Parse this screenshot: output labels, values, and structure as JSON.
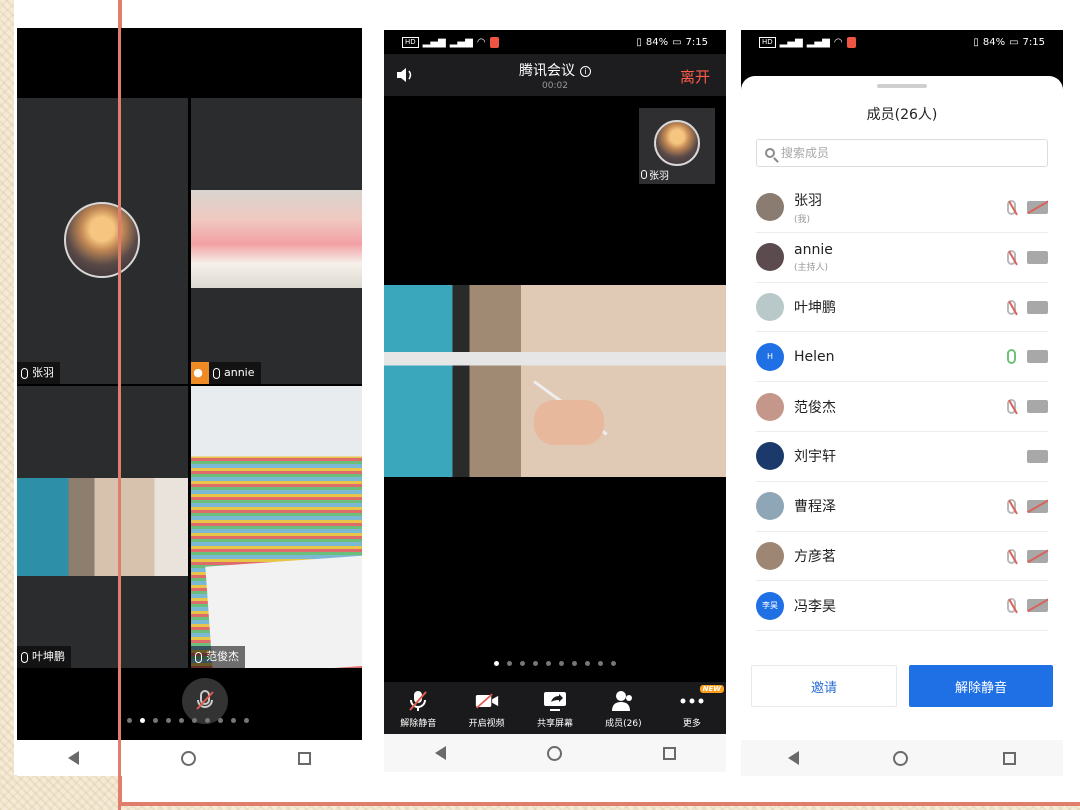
{
  "phone1": {
    "tiles": [
      {
        "name": "张羽",
        "type": "avatar"
      },
      {
        "name": "annie",
        "type": "video",
        "host": true
      },
      {
        "name": "叶坤鹏",
        "type": "video"
      },
      {
        "name": "范俊杰",
        "type": "video"
      }
    ],
    "pager": {
      "count": 10,
      "active": 1
    }
  },
  "phone2": {
    "status": {
      "battery": "84%",
      "time": "7:15"
    },
    "title": "腾讯会议",
    "timer": "00:02",
    "leave": "离开",
    "pip_name": "张羽",
    "pager": {
      "count": 10,
      "active": 0
    },
    "toolbar": [
      {
        "label": "解除静音",
        "icon": "muted-mic-icon"
      },
      {
        "label": "开启视频",
        "icon": "video-off-icon"
      },
      {
        "label": "共享屏幕",
        "icon": "share-screen-icon"
      },
      {
        "label": "成员(26)",
        "icon": "members-icon"
      },
      {
        "label": "更多",
        "icon": "more-icon",
        "badge": "NEW"
      }
    ]
  },
  "phone3": {
    "status": {
      "battery": "84%",
      "time": "7:15"
    },
    "title": "成员(26人)",
    "search_placeholder": "搜索成员",
    "members": [
      {
        "name": "张羽",
        "role": "(我)",
        "avatar_color": "#8a7c70",
        "mic": "muted",
        "cam": "off"
      },
      {
        "name": "annie",
        "role": "(主持人)",
        "avatar_color": "#5b4a4e",
        "mic": "muted",
        "cam": "on"
      },
      {
        "name": "叶坤鹏",
        "role": "",
        "avatar_color": "#b9c9c9",
        "mic": "muted",
        "cam": "on"
      },
      {
        "name": "Helen",
        "role": "",
        "avatar_color": "#1f6fe5",
        "avatar_text": "H",
        "mic": "active",
        "cam": "on"
      },
      {
        "name": "范俊杰",
        "role": "",
        "avatar_color": "#c4978a",
        "mic": "muted",
        "cam": "on"
      },
      {
        "name": "刘宇轩",
        "role": "",
        "avatar_color": "#1b3a6b",
        "mic": "none",
        "cam": "on"
      },
      {
        "name": "曹程泽",
        "role": "",
        "avatar_color": "#8fa6b7",
        "mic": "muted",
        "cam": "off"
      },
      {
        "name": "方彦茗",
        "role": "",
        "avatar_color": "#9d8774",
        "mic": "muted",
        "cam": "off"
      },
      {
        "name": "冯李昊",
        "role": "",
        "avatar_color": "#1f6fe5",
        "avatar_text": "李昊",
        "mic": "muted",
        "cam": "off"
      }
    ],
    "invite": "邀请",
    "unmute": "解除静音"
  }
}
